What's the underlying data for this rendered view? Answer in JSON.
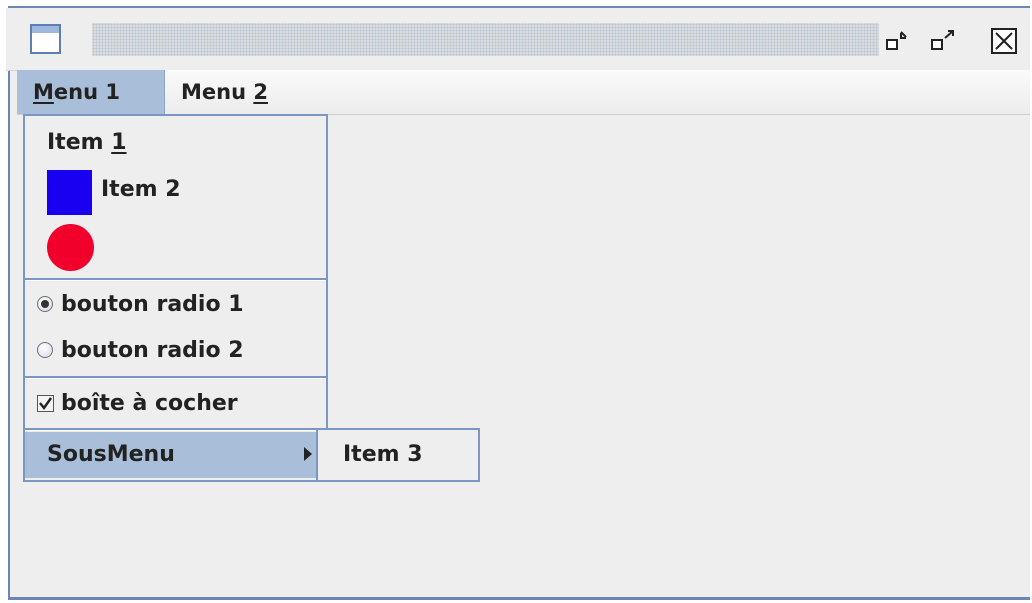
{
  "titlebar": {
    "icons": [
      "window-icon",
      "iconify-icon",
      "maximize-icon",
      "close-icon"
    ]
  },
  "menubar": {
    "menus": [
      {
        "pre": "",
        "mnemonic": "M",
        "post": "enu 1"
      },
      {
        "pre": "Menu ",
        "mnemonic": "2",
        "post": ""
      }
    ]
  },
  "popup": {
    "item1": {
      "pre": "Item ",
      "mnemonic": "1"
    },
    "item2": {
      "label": "Item 2",
      "icon": "blue-square-icon",
      "color": "#1a00f0"
    },
    "item_icon_only": {
      "icon": "red-circle-icon",
      "color": "#f0002a"
    },
    "radio1": {
      "label": "bouton radio 1",
      "selected": true
    },
    "radio2": {
      "label": "bouton radio 2",
      "selected": false
    },
    "checkbox": {
      "label": "boîte à cocher",
      "checked": true
    },
    "submenu": {
      "label": "SousMenu"
    }
  },
  "submenu": {
    "items": [
      {
        "label": "Item 3"
      }
    ]
  },
  "colors": {
    "selection": "#a9bfd9",
    "border": "#7a96c4",
    "background": "#eeeeee"
  }
}
